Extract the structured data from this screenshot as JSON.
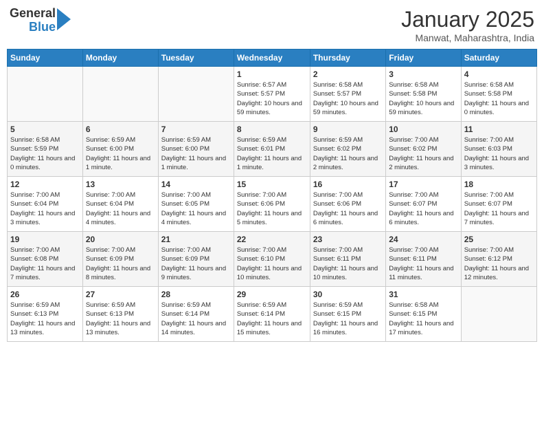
{
  "header": {
    "logo_line1": "General",
    "logo_line2": "Blue",
    "month_title": "January 2025",
    "location": "Manwat, Maharashtra, India"
  },
  "weekdays": [
    "Sunday",
    "Monday",
    "Tuesday",
    "Wednesday",
    "Thursday",
    "Friday",
    "Saturday"
  ],
  "weeks": [
    [
      {
        "day": "",
        "info": ""
      },
      {
        "day": "",
        "info": ""
      },
      {
        "day": "",
        "info": ""
      },
      {
        "day": "1",
        "info": "Sunrise: 6:57 AM\nSunset: 5:57 PM\nDaylight: 10 hours and 59 minutes."
      },
      {
        "day": "2",
        "info": "Sunrise: 6:58 AM\nSunset: 5:57 PM\nDaylight: 10 hours and 59 minutes."
      },
      {
        "day": "3",
        "info": "Sunrise: 6:58 AM\nSunset: 5:58 PM\nDaylight: 10 hours and 59 minutes."
      },
      {
        "day": "4",
        "info": "Sunrise: 6:58 AM\nSunset: 5:58 PM\nDaylight: 11 hours and 0 minutes."
      }
    ],
    [
      {
        "day": "5",
        "info": "Sunrise: 6:58 AM\nSunset: 5:59 PM\nDaylight: 11 hours and 0 minutes."
      },
      {
        "day": "6",
        "info": "Sunrise: 6:59 AM\nSunset: 6:00 PM\nDaylight: 11 hours and 1 minute."
      },
      {
        "day": "7",
        "info": "Sunrise: 6:59 AM\nSunset: 6:00 PM\nDaylight: 11 hours and 1 minute."
      },
      {
        "day": "8",
        "info": "Sunrise: 6:59 AM\nSunset: 6:01 PM\nDaylight: 11 hours and 1 minute."
      },
      {
        "day": "9",
        "info": "Sunrise: 6:59 AM\nSunset: 6:02 PM\nDaylight: 11 hours and 2 minutes."
      },
      {
        "day": "10",
        "info": "Sunrise: 7:00 AM\nSunset: 6:02 PM\nDaylight: 11 hours and 2 minutes."
      },
      {
        "day": "11",
        "info": "Sunrise: 7:00 AM\nSunset: 6:03 PM\nDaylight: 11 hours and 3 minutes."
      }
    ],
    [
      {
        "day": "12",
        "info": "Sunrise: 7:00 AM\nSunset: 6:04 PM\nDaylight: 11 hours and 3 minutes."
      },
      {
        "day": "13",
        "info": "Sunrise: 7:00 AM\nSunset: 6:04 PM\nDaylight: 11 hours and 4 minutes."
      },
      {
        "day": "14",
        "info": "Sunrise: 7:00 AM\nSunset: 6:05 PM\nDaylight: 11 hours and 4 minutes."
      },
      {
        "day": "15",
        "info": "Sunrise: 7:00 AM\nSunset: 6:06 PM\nDaylight: 11 hours and 5 minutes."
      },
      {
        "day": "16",
        "info": "Sunrise: 7:00 AM\nSunset: 6:06 PM\nDaylight: 11 hours and 6 minutes."
      },
      {
        "day": "17",
        "info": "Sunrise: 7:00 AM\nSunset: 6:07 PM\nDaylight: 11 hours and 6 minutes."
      },
      {
        "day": "18",
        "info": "Sunrise: 7:00 AM\nSunset: 6:07 PM\nDaylight: 11 hours and 7 minutes."
      }
    ],
    [
      {
        "day": "19",
        "info": "Sunrise: 7:00 AM\nSunset: 6:08 PM\nDaylight: 11 hours and 7 minutes."
      },
      {
        "day": "20",
        "info": "Sunrise: 7:00 AM\nSunset: 6:09 PM\nDaylight: 11 hours and 8 minutes."
      },
      {
        "day": "21",
        "info": "Sunrise: 7:00 AM\nSunset: 6:09 PM\nDaylight: 11 hours and 9 minutes."
      },
      {
        "day": "22",
        "info": "Sunrise: 7:00 AM\nSunset: 6:10 PM\nDaylight: 11 hours and 10 minutes."
      },
      {
        "day": "23",
        "info": "Sunrise: 7:00 AM\nSunset: 6:11 PM\nDaylight: 11 hours and 10 minutes."
      },
      {
        "day": "24",
        "info": "Sunrise: 7:00 AM\nSunset: 6:11 PM\nDaylight: 11 hours and 11 minutes."
      },
      {
        "day": "25",
        "info": "Sunrise: 7:00 AM\nSunset: 6:12 PM\nDaylight: 11 hours and 12 minutes."
      }
    ],
    [
      {
        "day": "26",
        "info": "Sunrise: 6:59 AM\nSunset: 6:13 PM\nDaylight: 11 hours and 13 minutes."
      },
      {
        "day": "27",
        "info": "Sunrise: 6:59 AM\nSunset: 6:13 PM\nDaylight: 11 hours and 13 minutes."
      },
      {
        "day": "28",
        "info": "Sunrise: 6:59 AM\nSunset: 6:14 PM\nDaylight: 11 hours and 14 minutes."
      },
      {
        "day": "29",
        "info": "Sunrise: 6:59 AM\nSunset: 6:14 PM\nDaylight: 11 hours and 15 minutes."
      },
      {
        "day": "30",
        "info": "Sunrise: 6:59 AM\nSunset: 6:15 PM\nDaylight: 11 hours and 16 minutes."
      },
      {
        "day": "31",
        "info": "Sunrise: 6:58 AM\nSunset: 6:15 PM\nDaylight: 11 hours and 17 minutes."
      },
      {
        "day": "",
        "info": ""
      }
    ]
  ]
}
